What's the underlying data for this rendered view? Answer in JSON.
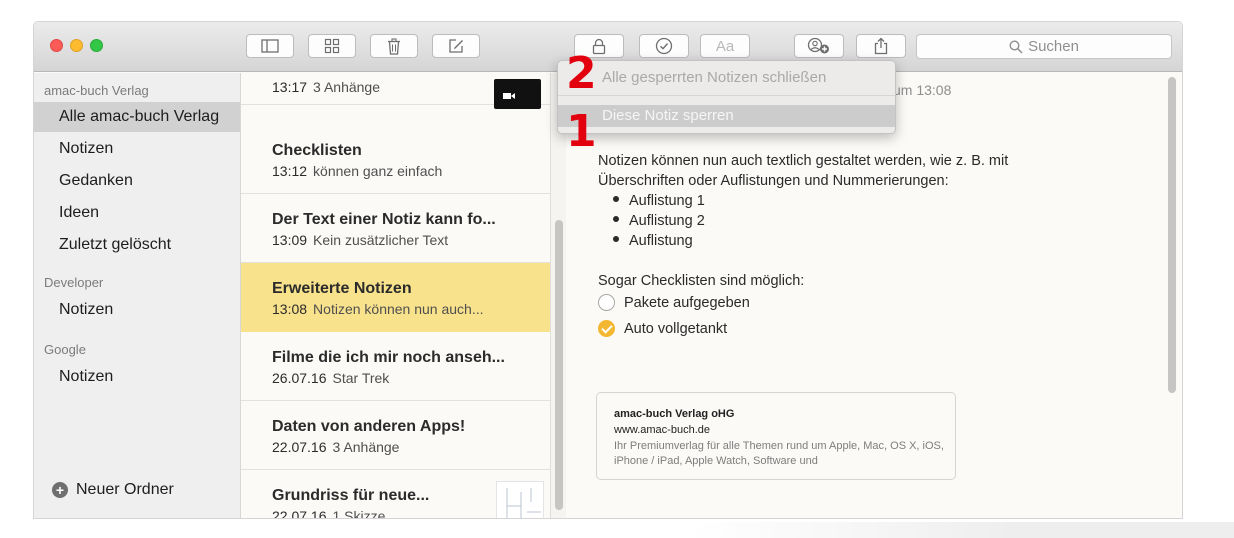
{
  "toolbar": {
    "search_placeholder": "Suchen",
    "format_label": "Aa"
  },
  "sidebar": {
    "groups": [
      {
        "title": "amac-buch Verlag",
        "items": [
          "Alle amac-buch Verlag",
          "Notizen",
          "Gedanken",
          "Ideen",
          "Zuletzt gelöscht"
        ]
      },
      {
        "title": "Developer",
        "items": [
          "Notizen"
        ]
      },
      {
        "title": "Google",
        "items": [
          "Notizen"
        ]
      }
    ],
    "new_folder": "Neuer Ordner"
  },
  "notes": [
    {
      "title": "",
      "time": "13:17",
      "preview": "3 Anhänge"
    },
    {
      "title": "Checklisten",
      "time": "13:12",
      "preview": "können ganz einfach"
    },
    {
      "title": "Der Text einer Notiz kann fo...",
      "time": "13:09",
      "preview": "Kein zusätzlicher Text"
    },
    {
      "title": "Erweiterte Notizen",
      "time": "13:08",
      "preview": "Notizen können nun auch..."
    },
    {
      "title": "Filme die ich mir noch anseh...",
      "time": "26.07.16",
      "preview": "Star Trek"
    },
    {
      "title": "Daten von anderen Apps!",
      "time": "22.07.16",
      "preview": "3 Anhänge"
    },
    {
      "title": "Grundriss für neue...",
      "time": "22.07.16",
      "preview": "1 Skizze"
    }
  ],
  "editor": {
    "date_fragment": "um 13:08",
    "intro_line1": "Notizen können nun auch textlich gestaltet werden, wie z. B. mit",
    "intro_line2": "Überschriften oder Auflistungen und Nummerierungen:",
    "bullets": [
      "Auflistung 1",
      "Auflistung 2",
      "Auflistung"
    ],
    "checklist_intro": "Sogar Checklisten sind möglich:",
    "checklist": [
      {
        "label": "Pakete aufgegeben",
        "done": false
      },
      {
        "label": "Auto vollgetankt",
        "done": true
      }
    ],
    "card": {
      "title": "amac-buch Verlag oHG",
      "url": "www.amac-buch.de",
      "desc": "Ihr Premiumverlag für alle Themen rund um Apple, Mac, OS X, iOS, iPhone / iPad, Apple Watch, Software und"
    }
  },
  "menu": {
    "close_all": "Alle gesperrten Notizen schließen",
    "lock_note": "Diese Notiz sperren"
  },
  "callouts": [
    "2",
    "1"
  ],
  "colors": {
    "selected_note": "#f9e28c",
    "check_done": "#f4b731",
    "callout": "#e2000f"
  }
}
